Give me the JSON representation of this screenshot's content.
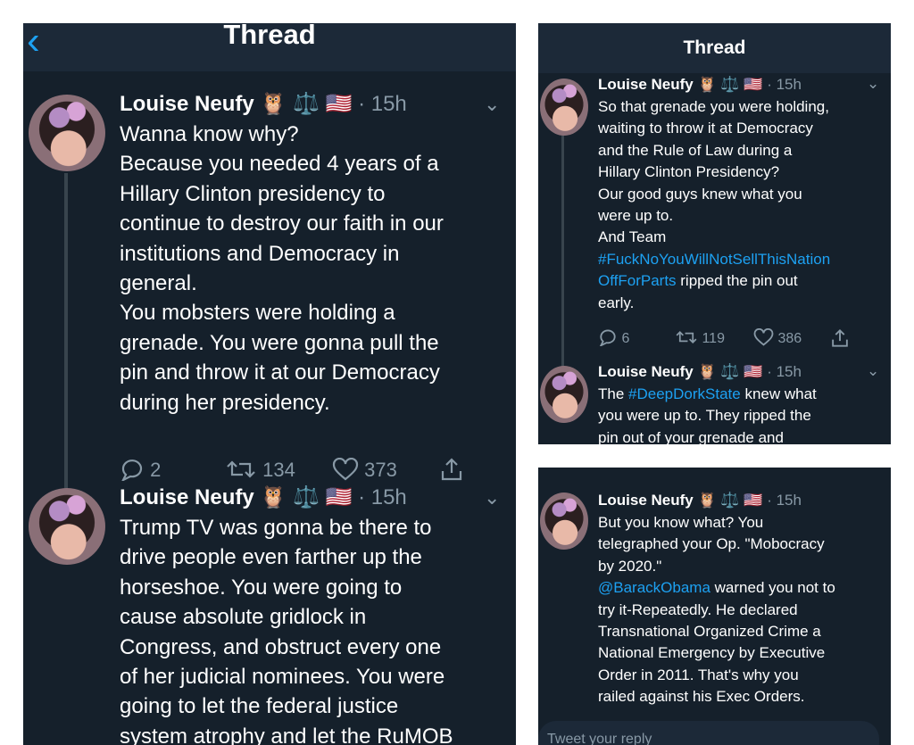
{
  "left": {
    "header": {
      "back_icon": "chevron-left-icon",
      "title": "Thread"
    },
    "tweets": [
      {
        "name": "Louise Neufy",
        "emojis": [
          "🦉",
          "⚖️",
          "🇺🇸"
        ],
        "time": "· 15h",
        "lines": [
          "Wanna know why?",
          "Because you needed 4 years of a",
          "Hillary Clinton presidency to",
          "continue to destroy our faith in our",
          "institutions and Democracy in",
          "general.",
          "You mobsters were holding a",
          "grenade. You were gonna pull the",
          "pin and throw it at our Democracy",
          "during her presidency."
        ],
        "replies": "2",
        "retweets": "134",
        "likes": "373"
      },
      {
        "name": "Louise Neufy",
        "emojis": [
          "🦉",
          "⚖️",
          "🇺🇸"
        ],
        "time": "· 15h",
        "lines": [
          "Trump TV was gonna be there to",
          "drive people even farther up the",
          "horseshoe. You were going to",
          "cause absolute gridlock in",
          "Congress, and obstruct every one",
          "of her judicial nominees. You were",
          "going to let the federal justice",
          "system atrophy and let the RuMOB"
        ]
      }
    ]
  },
  "right_top": {
    "header": {
      "title": "Thread"
    },
    "tweets": [
      {
        "name": "Louise Neufy",
        "emojis": [
          "🦉",
          "⚖️",
          "🇺🇸"
        ],
        "time": "· 15h",
        "lines": [
          "So that grenade you were holding,",
          "waiting to throw it at Democracy",
          "and the Rule of Law during a",
          "Hillary Clinton Presidency?",
          "Our good guys knew what you",
          "were up to.",
          "And Team"
        ],
        "hashtag_line1": "#FuckNoYouWillNotSellThisNation",
        "hashtag_line2": "OffForParts",
        "after_hashtag": " ripped the pin out",
        "last_line": "early.",
        "replies": "6",
        "retweets": "119",
        "likes": "386"
      },
      {
        "name": "Louise Neufy",
        "emojis": [
          "🦉",
          "⚖️",
          "🇺🇸"
        ],
        "time": "· 15h",
        "line1_pre": "The ",
        "line1_tag": "#DeepDorkState",
        "line1_post": " knew what",
        "lines": [
          "you were up to. They ripped the",
          "pin out of your grenade and"
        ]
      }
    ]
  },
  "right_bottom": {
    "tweet": {
      "name": "Louise Neufy",
      "emojis": [
        "🦉",
        "⚖️",
        "🇺🇸"
      ],
      "time": "· 15h",
      "lines_a": [
        "But you know what? You",
        "telegraphed your Op. \"Mobocracy",
        "by 2020.\""
      ],
      "mention": "@BarackObama",
      "mention_post": " warned you not to",
      "lines_b": [
        "try it-Repeatedly. He declared",
        "Transnational Organized Crime a",
        "National Emergency by Executive",
        "Order in 2011. That's why you",
        "railed against his Exec Orders."
      ]
    },
    "reply_placeholder": "Tweet your reply"
  },
  "colors": {
    "background": "#15202b",
    "header": "#1c2938",
    "accent": "#1da1f2",
    "muted": "#8899a6"
  }
}
